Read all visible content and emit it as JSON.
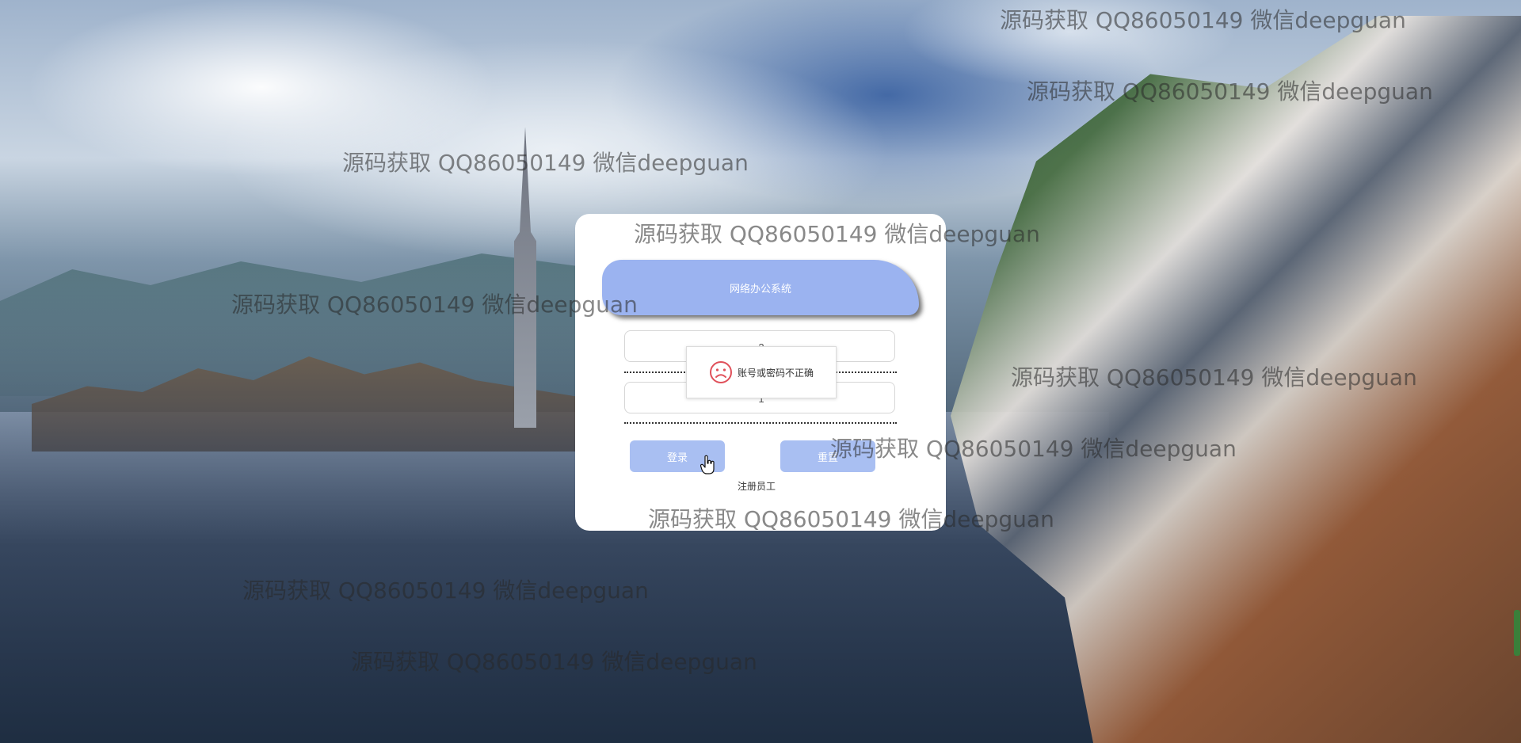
{
  "app": {
    "title": "网络办公系统"
  },
  "login_form": {
    "username_value": "2",
    "password_value": "1",
    "login_label": "登录",
    "reset_label": "重置",
    "register_label": "注册员工"
  },
  "toast": {
    "icon": "sad-face-icon",
    "message": "账号或密码不正确"
  },
  "watermarks": [
    "源码获取 QQ86050149 微信deepguan",
    "源码获取 QQ86050149 微信deepguan",
    "源码获取 QQ86050149 微信deepguan",
    "源码获取 QQ86050149 微信deepguan",
    "源码获取 QQ86050149 微信deepguan",
    "源码获取 QQ86050149 微信deepguan",
    "源码获取 QQ86050149 微信deepguan",
    "源码获取 QQ86050149 微信deepguan",
    "源码获取 QQ86050149 微信deepguan",
    "源码获取 QQ86050149 微信deepguan"
  ],
  "colors": {
    "header_bar": "#9bb3f0",
    "button": "#a9bff2",
    "toast_icon": "#e0505a"
  }
}
